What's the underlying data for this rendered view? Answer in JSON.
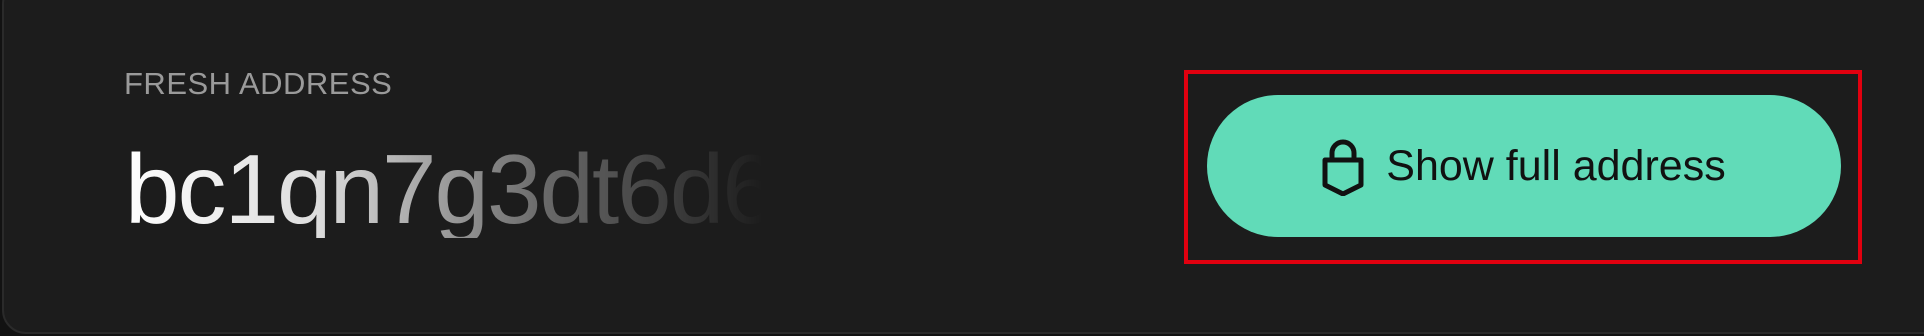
{
  "fresh_address": {
    "label": "FRESH ADDRESS",
    "value": "bc1qn7g3dt6d6"
  },
  "show_button": {
    "label": "Show full address",
    "icon": "lock-icon",
    "background": "#61dbb8"
  },
  "colors": {
    "panel_bg": "#1c1c1c",
    "highlight_border": "#e1000f"
  }
}
